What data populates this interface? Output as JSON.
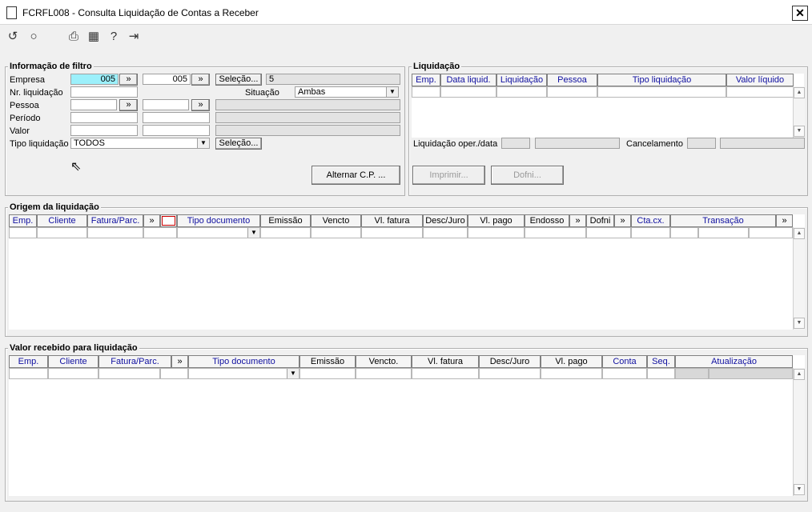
{
  "window": {
    "title": "FCRFL008 - Consulta Liquidação de Contas a Receber",
    "close_label": "✕"
  },
  "toolbar": {
    "icons": [
      "undo-icon",
      "search-icon",
      "print-icon",
      "calendar-icon",
      "help-icon",
      "exit-icon"
    ]
  },
  "filter": {
    "title": "Informação de filtro",
    "empresa_label": "Empresa",
    "empresa_from": "005",
    "empresa_to": "005",
    "arrow_label": "»",
    "selecao_label": "Seleção...",
    "empresa_count": "5",
    "nr_liquidacao_label": "Nr. liquidação",
    "situacao_label": "Situação",
    "situacao_value": "Ambas",
    "pessoa_label": "Pessoa",
    "periodo_label": "Período",
    "valor_label": "Valor",
    "tipo_liquidacao_label": "Tipo liquidação",
    "tipo_liquidacao_value": "TODOS",
    "tipo_selecao_label": "Seleção...",
    "alternar_label": "Alternar C.P. ..."
  },
  "liquidacao": {
    "title": "Liquidação",
    "columns": [
      "Emp.",
      "Data liquid.",
      "Liquidação",
      "Pessoa",
      "Tipo liquidação",
      "Valor líquido"
    ],
    "oper_data_label": "Liquidação oper./data",
    "cancelamento_label": "Cancelamento",
    "imprimir_label": "Imprimir...",
    "dofni_label": "Dofni..."
  },
  "origem": {
    "title": "Origem da liquidação",
    "columns": [
      "Emp.",
      "Cliente",
      "Fatura/Parc.",
      "»",
      "",
      "Tipo documento",
      "Emissão",
      "Vencto",
      "Vl. fatura",
      "Desc/Juro",
      "Vl. pago",
      "Endosso",
      "»",
      "Dofni",
      "»",
      "Cta.cx.",
      "Transação",
      "»"
    ]
  },
  "valor_recebido": {
    "title": "Valor recebido para liquidação",
    "columns": [
      "Emp.",
      "Cliente",
      "Fatura/Parc.",
      "»",
      "Tipo documento",
      "Emissão",
      "Vencto.",
      "Vl. fatura",
      "Desc/Juro",
      "Vl. pago",
      "Conta",
      "Seq.",
      "Atualização"
    ]
  }
}
